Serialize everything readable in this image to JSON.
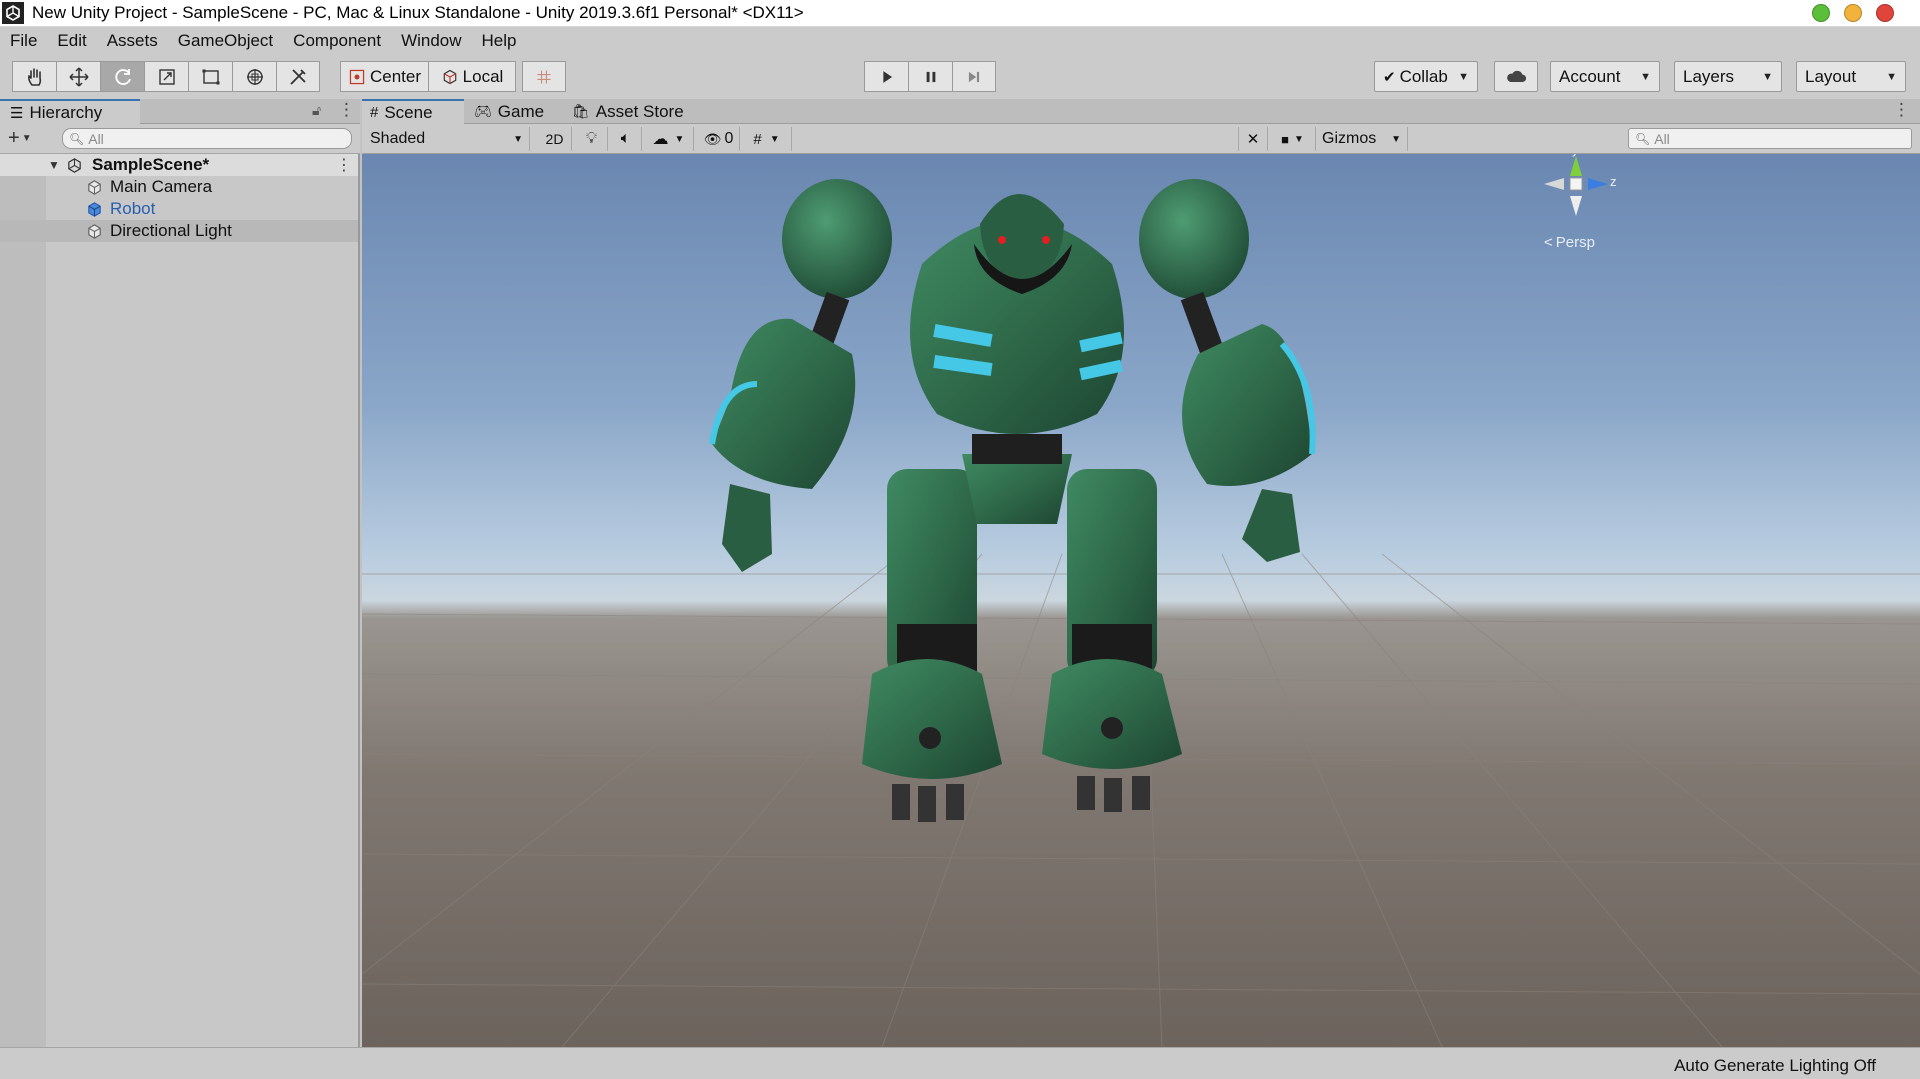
{
  "window": {
    "title": "New Unity Project - SampleScene - PC, Mac & Linux Standalone - Unity 2019.3.6f1 Personal* <DX11>",
    "controls": [
      "minimize",
      "maximize",
      "close"
    ],
    "control_colors": [
      "#5bbf3a",
      "#f1b33b",
      "#e0443a"
    ]
  },
  "menu": [
    "File",
    "Edit",
    "Assets",
    "GameObject",
    "Component",
    "Window",
    "Help"
  ],
  "toolbar": {
    "tools": [
      "hand-tool",
      "move-tool",
      "rotate-tool",
      "scale-tool",
      "rect-tool",
      "transform-tool",
      "custom-tool"
    ],
    "active_tool": "rotate-tool",
    "pivot_label": "Center",
    "space_label": "Local",
    "play_controls": [
      "play",
      "pause",
      "step"
    ],
    "collab_label": "Collab",
    "account_label": "Account",
    "layers_label": "Layers",
    "layout_label": "Layout"
  },
  "hierarchy": {
    "tab_label": "Hierarchy",
    "search_placeholder": "All",
    "scene_name": "SampleScene*",
    "items": [
      {
        "label": "Main Camera",
        "color": "#111111"
      },
      {
        "label": "Robot",
        "color": "#2a5fb0"
      },
      {
        "label": "Directional Light",
        "color": "#111111"
      }
    ]
  },
  "scene": {
    "tabs": [
      "Scene",
      "Game",
      "Asset Store"
    ],
    "active_tab": "Scene",
    "shading_mode": "Shaded",
    "mode_2d": "2D",
    "hidden_count": "0",
    "gizmos_label": "Gizmos",
    "search_placeholder": "All",
    "gizmo_axes": {
      "y": "y",
      "z": "z"
    },
    "projection_label": "Persp"
  },
  "status": {
    "text": "Auto Generate Lighting Off"
  },
  "colors": {
    "robot_body": "#2f6a4a",
    "robot_accent": "#45c7e6",
    "robot_eyes": "#e02020",
    "sky_top": "#6a87b1",
    "ground": "#7a726c"
  }
}
